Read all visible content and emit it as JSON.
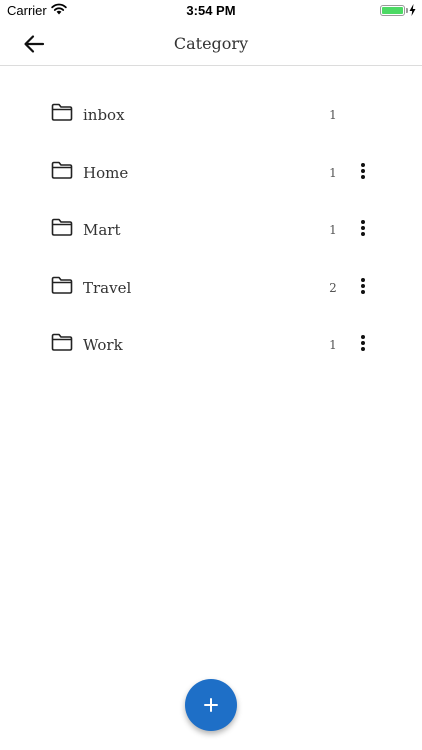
{
  "status_bar": {
    "carrier": "Carrier",
    "time": "3:54 PM",
    "battery_level": 1.0,
    "battery_color": "#4cd964"
  },
  "nav": {
    "title": "Category",
    "back_icon": "arrow-left-icon"
  },
  "categories": [
    {
      "label": "inbox",
      "count": "1",
      "icon": "folder-icon",
      "has_menu": false
    },
    {
      "label": "Home",
      "count": "1",
      "icon": "folder-icon",
      "has_menu": true
    },
    {
      "label": "Mart",
      "count": "1",
      "icon": "folder-icon",
      "has_menu": true
    },
    {
      "label": "Travel",
      "count": "2",
      "icon": "folder-icon",
      "has_menu": true
    },
    {
      "label": "Work",
      "count": "1",
      "icon": "folder-icon",
      "has_menu": true
    }
  ],
  "fab": {
    "icon": "plus-icon",
    "color": "#1e6fc7"
  }
}
